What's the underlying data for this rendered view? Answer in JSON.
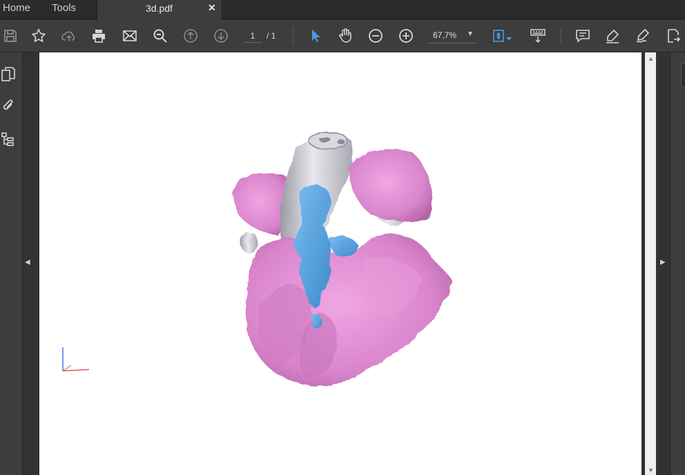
{
  "tabs": {
    "home": "Home",
    "tools": "Tools",
    "document": "3d.pdf",
    "close_symbol": "✕"
  },
  "toolbar": {
    "current_page": "1",
    "page_total": "/ 1",
    "zoom": "67,7%",
    "zoom_caret": "▼",
    "icons": [
      "save-icon",
      "bookmark-star-icon",
      "upload-cloud-icon",
      "print-icon",
      "email-icon",
      "zoom-search-icon",
      "page-up-icon",
      "page-down-icon",
      "select-arrow-icon",
      "hand-pan-icon",
      "zoom-out-icon",
      "zoom-in-icon",
      "fit-page-icon",
      "keyboard-icon",
      "comment-icon",
      "highlight-icon",
      "sign-icon",
      "send-icon"
    ],
    "accent": "#4a9be8"
  },
  "left_panel": {
    "icons": [
      "pages-icon",
      "attachment-icon",
      "layers-icon"
    ],
    "collapse_arrow": "◀"
  },
  "right_panel": {
    "collapse_arrow": "▶"
  },
  "scrollbar": {
    "up": "▲",
    "down": "▼"
  },
  "model": {
    "colors": {
      "tissue": "#e08ad2",
      "vessel": "#c9c9d2",
      "blood": "#5aa8e6",
      "axis_x": "#e03030",
      "axis_y": "#3050e0"
    }
  }
}
